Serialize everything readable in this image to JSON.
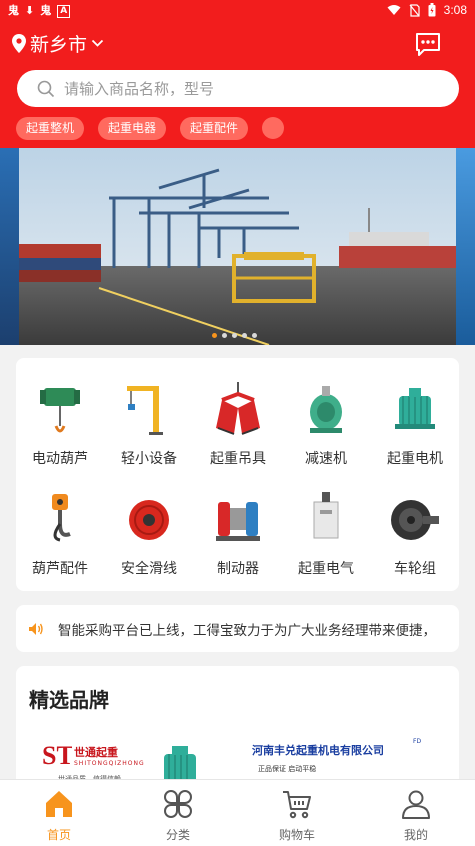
{
  "status_bar": {
    "left_glyphs": [
      "鬼",
      "⬇",
      "鬼",
      "A"
    ],
    "time": "3:08"
  },
  "header": {
    "location": "新乡市",
    "search_placeholder": "请输入商品名称，型号",
    "quick_tags": [
      "起重整机",
      "起重电器",
      "起重配件"
    ]
  },
  "banner": {
    "slide_count": 5,
    "active_index": 0
  },
  "categories": [
    {
      "label": "电动葫芦",
      "icon": "electric-hoist-icon"
    },
    {
      "label": "轻小设备",
      "icon": "jib-crane-icon"
    },
    {
      "label": "起重吊具",
      "icon": "grab-bucket-icon"
    },
    {
      "label": "减速机",
      "icon": "reducer-icon"
    },
    {
      "label": "起重电机",
      "icon": "motor-icon"
    },
    {
      "label": "葫芦配件",
      "icon": "hook-icon"
    },
    {
      "label": "安全滑线",
      "icon": "cable-reel-icon"
    },
    {
      "label": "制动器",
      "icon": "brake-icon"
    },
    {
      "label": "起重电气",
      "icon": "electrical-box-icon"
    },
    {
      "label": "车轮组",
      "icon": "wheel-icon"
    }
  ],
  "notice": {
    "text": "智能采购平台已上线，工得宝致力于为广大业务经理带来便捷，"
  },
  "brands": {
    "title": "精选品牌",
    "brand_1": {
      "logo": "ST",
      "name": "世通起重",
      "sub": "SHITONGQIZHONG",
      "slogan": "世通品质，值得信赖"
    },
    "brand_2": {
      "name": "河南丰兑起重机电有限公司",
      "sup": "FD",
      "slogan": "正品保证   启动平稳"
    }
  },
  "tabbar": {
    "tabs": [
      {
        "label": "首页",
        "icon": "home-icon",
        "active": true
      },
      {
        "label": "分类",
        "icon": "category-icon",
        "active": false
      },
      {
        "label": "购物车",
        "icon": "cart-icon",
        "active": false
      },
      {
        "label": "我的",
        "icon": "user-icon",
        "active": false
      }
    ]
  },
  "colors": {
    "brand_red": "#f21d1d",
    "tag_bg": "#ff6a5f",
    "accent_orange": "#f7941d"
  }
}
